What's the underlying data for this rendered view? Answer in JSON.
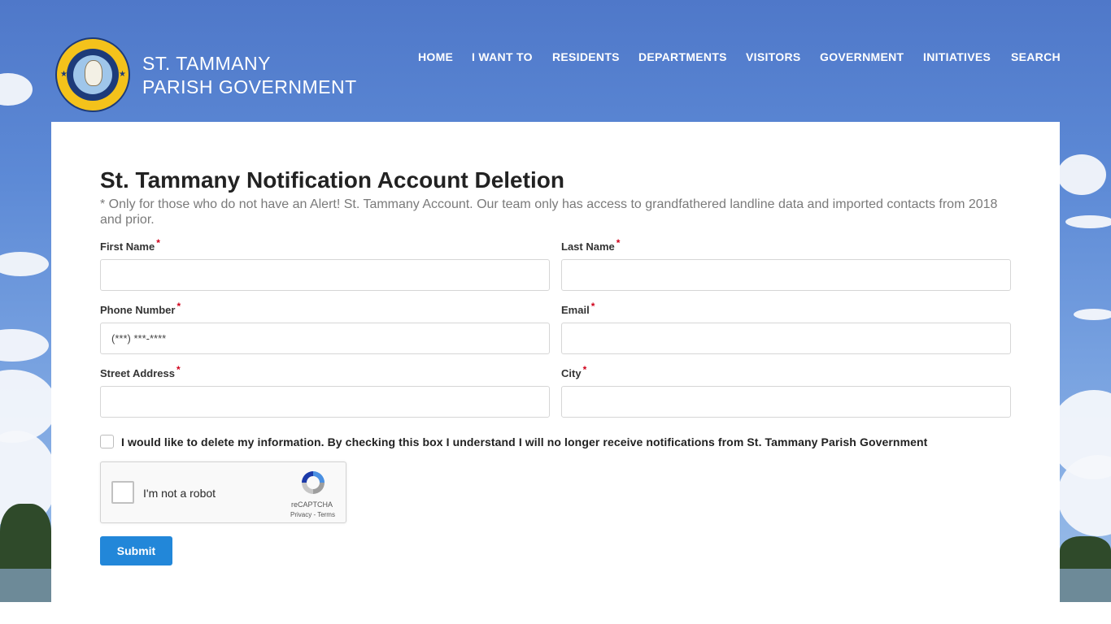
{
  "header": {
    "brand_line1": "ST. TAMMANY",
    "brand_line2": "PARISH GOVERNMENT",
    "logo_name": "parish-seal"
  },
  "nav": {
    "items": [
      {
        "label": "HOME"
      },
      {
        "label": "I WANT TO"
      },
      {
        "label": "RESIDENTS"
      },
      {
        "label": "DEPARTMENTS"
      },
      {
        "label": "VISITORS"
      },
      {
        "label": "GOVERNMENT"
      },
      {
        "label": "INITIATIVES"
      },
      {
        "label": "SEARCH"
      }
    ]
  },
  "form": {
    "title": "St. Tammany Notification Account Deletion",
    "note": "* Only for those who do not have an Alert! St. Tammany Account. Our team only has access to grandfathered landline data and imported contacts from 2018 and prior.",
    "required_marker": "*",
    "fields": {
      "first_name": {
        "label": "First Name",
        "value": "",
        "placeholder": ""
      },
      "last_name": {
        "label": "Last Name",
        "value": "",
        "placeholder": ""
      },
      "phone": {
        "label": "Phone Number",
        "value": "",
        "placeholder": "(***) ***-****"
      },
      "email": {
        "label": "Email",
        "value": "",
        "placeholder": ""
      },
      "street": {
        "label": "Street Address",
        "value": "",
        "placeholder": ""
      },
      "city": {
        "label": "City",
        "value": "",
        "placeholder": ""
      }
    },
    "consent_label": "I would like to delete my information. By checking this box I understand I will no longer receive notifications from St. Tammany Parish Government",
    "consent_checked": false,
    "captcha": {
      "text": "I'm not a robot",
      "brand": "reCAPTCHA",
      "links": "Privacy - Terms"
    },
    "submit_label": "Submit"
  },
  "colors": {
    "accent": "#2287d9",
    "required": "#d0021b",
    "sky": "#4f78c9"
  }
}
